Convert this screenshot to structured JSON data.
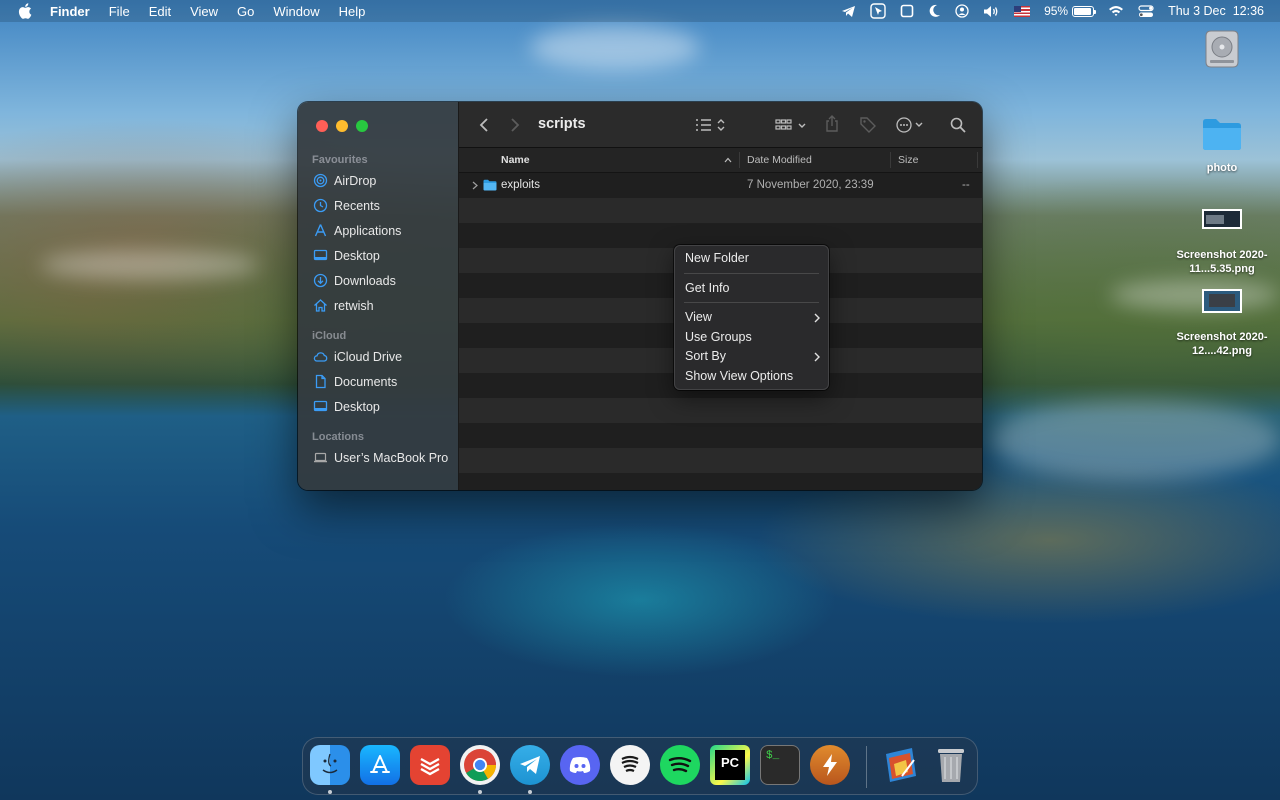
{
  "menubar": {
    "app_name": "Finder",
    "menus": [
      "File",
      "Edit",
      "View",
      "Go",
      "Window",
      "Help"
    ],
    "battery_percent": "95%",
    "battery_level": 0.95,
    "datetime": "Thu 3 Dec  12:36",
    "status_icons": [
      "telegram-icon",
      "cursor-icon",
      "square-icon",
      "moon-icon",
      "user-icon",
      "volume-icon",
      "us-flag-icon",
      "battery-icon",
      "wifi-icon",
      "control-center-icon"
    ]
  },
  "desktop": {
    "icons": [
      {
        "name": "drive-icon",
        "label": ""
      },
      {
        "name": "folder-icon",
        "label": "photo"
      },
      {
        "name": "screenshot-thumb-icon",
        "label": "Screenshot 2020-11...5.35.png"
      },
      {
        "name": "screenshot-thumb-icon",
        "label": "Screenshot 2020-12....42.png"
      }
    ]
  },
  "finder": {
    "title": "scripts",
    "sidebar": {
      "favourites_label": "Favourites",
      "favourites": [
        {
          "label": "AirDrop",
          "icon": "airdrop-icon"
        },
        {
          "label": "Recents",
          "icon": "clock-icon"
        },
        {
          "label": "Applications",
          "icon": "applications-icon"
        },
        {
          "label": "Desktop",
          "icon": "desktop-icon"
        },
        {
          "label": "Downloads",
          "icon": "download-icon"
        },
        {
          "label": "retwish",
          "icon": "home-icon"
        }
      ],
      "icloud_label": "iCloud",
      "icloud": [
        {
          "label": "iCloud Drive",
          "icon": "cloud-icon"
        },
        {
          "label": "Documents",
          "icon": "document-icon"
        },
        {
          "label": "Desktop",
          "icon": "desktop-icon"
        }
      ],
      "locations_label": "Locations",
      "locations": [
        {
          "label": "User’s MacBook Pro",
          "icon": "laptop-icon"
        }
      ]
    },
    "columns": {
      "name": "Name",
      "date": "Date Modified",
      "size": "Size"
    },
    "files": [
      {
        "name": "exploits",
        "date": "7 November 2020, 23:39",
        "size": "--"
      }
    ]
  },
  "context_menu": {
    "items": [
      {
        "label": "New Folder",
        "submenu": false
      },
      {
        "label": "Get Info",
        "submenu": false
      },
      {
        "label": "View",
        "submenu": true
      },
      {
        "label": "Use Groups",
        "submenu": false
      },
      {
        "label": "Sort By",
        "submenu": true
      },
      {
        "label": "Show View Options",
        "submenu": false
      }
    ]
  },
  "dock": {
    "apps": [
      "Finder",
      "App Store",
      "Todoist",
      "Google Chrome",
      "Telegram",
      "Discord",
      "Warp",
      "Spotify",
      "PyCharm",
      "Terminal",
      "Reeder"
    ],
    "extras": [
      "Downloads stack",
      "Trash"
    ]
  }
}
